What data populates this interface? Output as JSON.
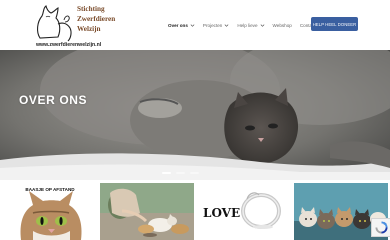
{
  "site": {
    "logo_lines": [
      "Stichting",
      "Zwerfdieren",
      "Welzijn"
    ],
    "logo_url": "www.zwerfdierenwelzijn.nl"
  },
  "nav": {
    "items": [
      {
        "label": "Over ons",
        "has_dropdown": true,
        "active": true
      },
      {
        "label": "Projecten",
        "has_dropdown": true,
        "active": false
      },
      {
        "label": "Help lieve",
        "has_dropdown": true,
        "active": false
      },
      {
        "label": "Webshop",
        "has_dropdown": false,
        "active": false
      },
      {
        "label": "Contact",
        "has_dropdown": false,
        "active": false
      }
    ],
    "cta_label": "HELP HEEL DONEER"
  },
  "hero": {
    "title": "OVER ONS",
    "slides_count": 3,
    "active_slide": 1
  },
  "tiles": [
    {
      "caption": "BAASJE OP AFSTAND",
      "image": "cat-portrait"
    },
    {
      "caption": "",
      "image": "person-feeding-cats"
    },
    {
      "caption": "",
      "image": "love-ring-jewelry"
    },
    {
      "caption": "",
      "image": "group-of-cats"
    }
  ],
  "tile_texts": {
    "love": "LOVE"
  },
  "colors": {
    "accent": "#3a5fa0",
    "logo_brown": "#7a4b2a",
    "hero_grey": "#7a7a78"
  },
  "icons": {
    "captcha": "recaptcha-icon",
    "caret": "chevron-down-icon"
  }
}
